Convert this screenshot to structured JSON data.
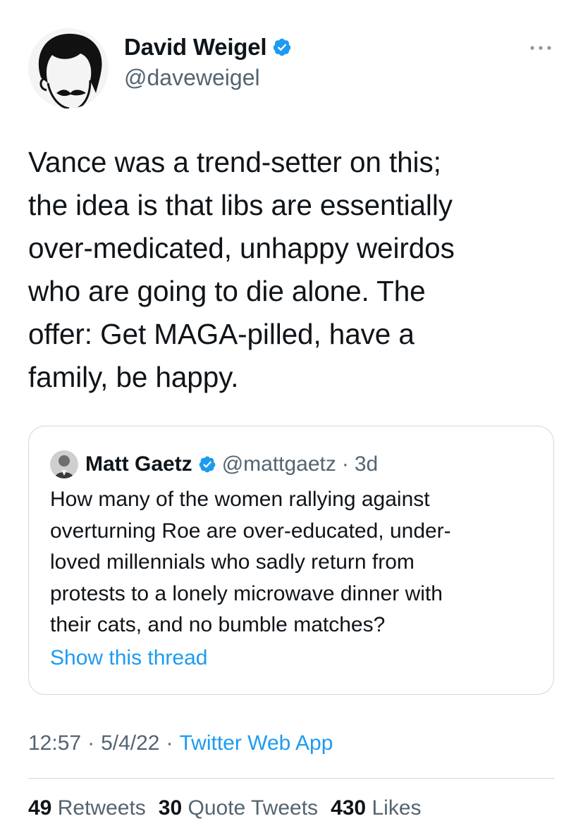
{
  "author": {
    "name": "David Weigel",
    "handle": "@daveweigel",
    "verified": true,
    "avatar_icon": "caricature-avatar"
  },
  "more_icon": "ellipsis-icon",
  "tweet": {
    "text": "Vance was a trend-setter on this;\nthe idea is that libs are essentially\nover-medicated, unhappy weirdos\nwho are going to die alone. The\noffer: Get MAGA-pilled, have a\nfamily, be happy."
  },
  "quoted_tweet": {
    "name": "Matt Gaetz",
    "handle": "@mattgaetz",
    "separator": "·",
    "age": "3d",
    "verified": true,
    "text": "How many of the women rallying against\noverturning Roe are over-educated, under-\nloved millennials who sadly return from\nprotests to a lonely microwave dinner with\ntheir cats, and no bumble matches?",
    "show_thread_label": "Show this thread"
  },
  "meta": {
    "time": "12:57",
    "separator": "·",
    "date": "5/4/22",
    "source": "Twitter Web App"
  },
  "stats": {
    "retweets_count": "49",
    "retweets_label": "Retweets",
    "quotes_count": "30",
    "quotes_label": "Quote Tweets",
    "likes_count": "430",
    "likes_label": "Likes"
  },
  "colors": {
    "text": "#0f1419",
    "secondary": "#536471",
    "link": "#1d9bf0",
    "verified": "#1d9bf0",
    "border": "#cfd9de"
  }
}
